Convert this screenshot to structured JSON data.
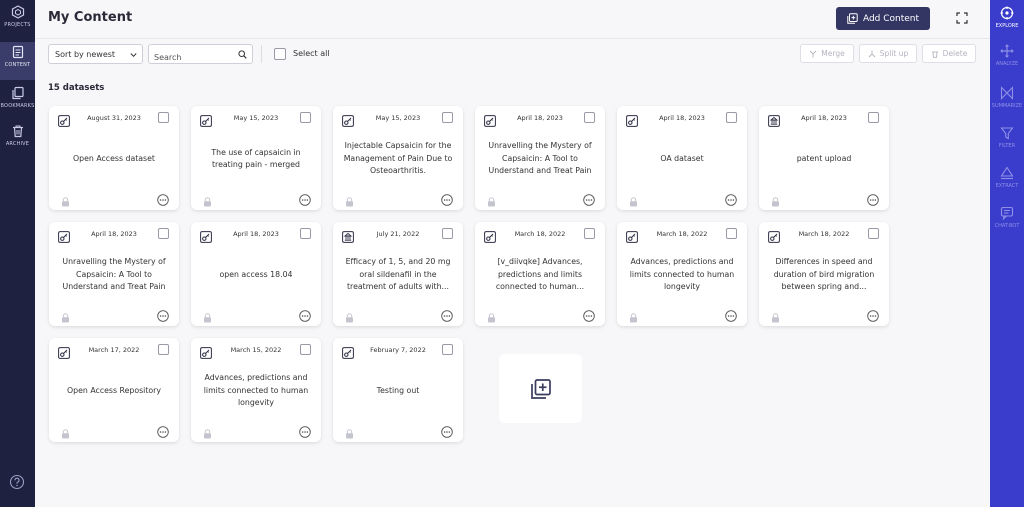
{
  "left_nav": {
    "items": [
      {
        "label": "PROJECTS",
        "icon": "hexagon-icon",
        "active": false
      },
      {
        "label": "CONTENT",
        "icon": "document-list-icon",
        "active": true
      },
      {
        "label": "BOOKMARKS",
        "icon": "bookmark-copy-icon",
        "active": false
      },
      {
        "label": "ARCHIVE",
        "icon": "trash-icon",
        "active": false
      }
    ],
    "help_icon": "question-icon"
  },
  "right_nav": {
    "items": [
      {
        "label": "EXPLORE",
        "icon": "explore-icon",
        "active": true
      },
      {
        "label": "ANALYZE",
        "icon": "analyze-icon",
        "active": false
      },
      {
        "label": "SUMMARIZE",
        "icon": "summarize-icon",
        "active": false
      },
      {
        "label": "FILTER",
        "icon": "filter-icon",
        "active": false
      },
      {
        "label": "EXTRACT",
        "icon": "extract-icon",
        "active": false
      },
      {
        "label": "CHAT-BOT",
        "icon": "chat-icon",
        "active": false
      }
    ]
  },
  "header": {
    "title": "My Content",
    "add_content_label": "Add Content"
  },
  "toolbar": {
    "sort_value": "Sort by newest",
    "search_placeholder": "Search",
    "select_all_label": "Select all",
    "merge_label": "Merge",
    "split_label": "Split up",
    "delete_label": "Delete"
  },
  "dataset_count": "15 datasets",
  "datasets": [
    {
      "date": "August 31, 2023",
      "title": "Open Access dataset",
      "type": "key"
    },
    {
      "date": "May 15, 2023",
      "title": "The use of capsaicin in treating pain - merged",
      "type": "key"
    },
    {
      "date": "May 15, 2023",
      "title": "Injectable Capsaicin for the Management of Pain Due to Osteoarthritis.",
      "type": "key"
    },
    {
      "date": "April 18, 2023",
      "title": "Unravelling the Mystery of Capsaicin: A Tool to Understand and Treat Pain",
      "type": "key"
    },
    {
      "date": "April 18, 2023",
      "title": "OA dataset",
      "type": "key"
    },
    {
      "date": "April 18, 2023",
      "title": "patent upload",
      "type": "patent"
    },
    {
      "date": "April 18, 2023",
      "title": "Unravelling the Mystery of Capsaicin: A Tool to Understand and Treat Pain",
      "type": "key"
    },
    {
      "date": "April 18, 2023",
      "title": "open access 18.04",
      "type": "key"
    },
    {
      "date": "July 21, 2022",
      "title": "Efficacy of 1, 5, and 20 mg oral sildenafil in the treatment of adults with...",
      "type": "patent"
    },
    {
      "date": "March 18, 2022",
      "title": "[v_diivqke] Advances, predictions and limits connected to human...",
      "type": "key"
    },
    {
      "date": "March 18, 2022",
      "title": "Advances, predictions and limits connected to human longevity",
      "type": "key"
    },
    {
      "date": "March 18, 2022",
      "title": "Differences in speed and duration of bird migration between spring and...",
      "type": "key"
    },
    {
      "date": "March 17, 2022",
      "title": "Open Access Repository",
      "type": "key"
    },
    {
      "date": "March 15, 2022",
      "title": "Advances, predictions and limits connected to human longevity",
      "type": "key"
    },
    {
      "date": "February 7, 2022",
      "title": "Testing out",
      "type": "key"
    }
  ]
}
